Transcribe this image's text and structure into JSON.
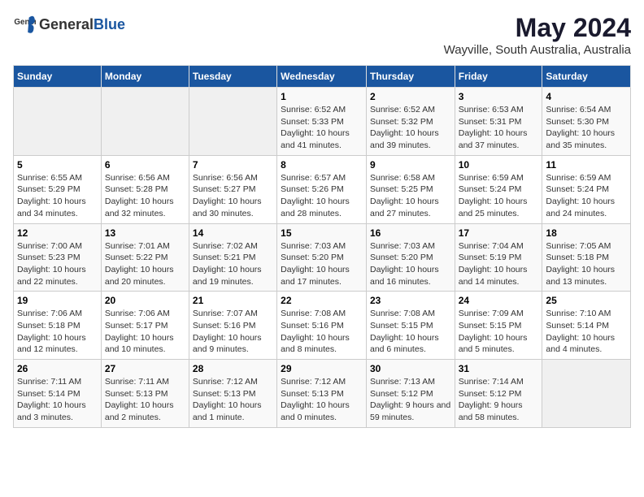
{
  "header": {
    "logo_general": "General",
    "logo_blue": "Blue",
    "title": "May 2024",
    "subtitle": "Wayville, South Australia, Australia"
  },
  "days_of_week": [
    "Sunday",
    "Monday",
    "Tuesday",
    "Wednesday",
    "Thursday",
    "Friday",
    "Saturday"
  ],
  "weeks": [
    [
      {
        "day": "",
        "empty": true
      },
      {
        "day": "",
        "empty": true
      },
      {
        "day": "",
        "empty": true
      },
      {
        "day": "1",
        "sunrise": "Sunrise: 6:52 AM",
        "sunset": "Sunset: 5:33 PM",
        "daylight": "Daylight: 10 hours and 41 minutes."
      },
      {
        "day": "2",
        "sunrise": "Sunrise: 6:52 AM",
        "sunset": "Sunset: 5:32 PM",
        "daylight": "Daylight: 10 hours and 39 minutes."
      },
      {
        "day": "3",
        "sunrise": "Sunrise: 6:53 AM",
        "sunset": "Sunset: 5:31 PM",
        "daylight": "Daylight: 10 hours and 37 minutes."
      },
      {
        "day": "4",
        "sunrise": "Sunrise: 6:54 AM",
        "sunset": "Sunset: 5:30 PM",
        "daylight": "Daylight: 10 hours and 35 minutes."
      }
    ],
    [
      {
        "day": "5",
        "sunrise": "Sunrise: 6:55 AM",
        "sunset": "Sunset: 5:29 PM",
        "daylight": "Daylight: 10 hours and 34 minutes."
      },
      {
        "day": "6",
        "sunrise": "Sunrise: 6:56 AM",
        "sunset": "Sunset: 5:28 PM",
        "daylight": "Daylight: 10 hours and 32 minutes."
      },
      {
        "day": "7",
        "sunrise": "Sunrise: 6:56 AM",
        "sunset": "Sunset: 5:27 PM",
        "daylight": "Daylight: 10 hours and 30 minutes."
      },
      {
        "day": "8",
        "sunrise": "Sunrise: 6:57 AM",
        "sunset": "Sunset: 5:26 PM",
        "daylight": "Daylight: 10 hours and 28 minutes."
      },
      {
        "day": "9",
        "sunrise": "Sunrise: 6:58 AM",
        "sunset": "Sunset: 5:25 PM",
        "daylight": "Daylight: 10 hours and 27 minutes."
      },
      {
        "day": "10",
        "sunrise": "Sunrise: 6:59 AM",
        "sunset": "Sunset: 5:24 PM",
        "daylight": "Daylight: 10 hours and 25 minutes."
      },
      {
        "day": "11",
        "sunrise": "Sunrise: 6:59 AM",
        "sunset": "Sunset: 5:24 PM",
        "daylight": "Daylight: 10 hours and 24 minutes."
      }
    ],
    [
      {
        "day": "12",
        "sunrise": "Sunrise: 7:00 AM",
        "sunset": "Sunset: 5:23 PM",
        "daylight": "Daylight: 10 hours and 22 minutes."
      },
      {
        "day": "13",
        "sunrise": "Sunrise: 7:01 AM",
        "sunset": "Sunset: 5:22 PM",
        "daylight": "Daylight: 10 hours and 20 minutes."
      },
      {
        "day": "14",
        "sunrise": "Sunrise: 7:02 AM",
        "sunset": "Sunset: 5:21 PM",
        "daylight": "Daylight: 10 hours and 19 minutes."
      },
      {
        "day": "15",
        "sunrise": "Sunrise: 7:03 AM",
        "sunset": "Sunset: 5:20 PM",
        "daylight": "Daylight: 10 hours and 17 minutes."
      },
      {
        "day": "16",
        "sunrise": "Sunrise: 7:03 AM",
        "sunset": "Sunset: 5:20 PM",
        "daylight": "Daylight: 10 hours and 16 minutes."
      },
      {
        "day": "17",
        "sunrise": "Sunrise: 7:04 AM",
        "sunset": "Sunset: 5:19 PM",
        "daylight": "Daylight: 10 hours and 14 minutes."
      },
      {
        "day": "18",
        "sunrise": "Sunrise: 7:05 AM",
        "sunset": "Sunset: 5:18 PM",
        "daylight": "Daylight: 10 hours and 13 minutes."
      }
    ],
    [
      {
        "day": "19",
        "sunrise": "Sunrise: 7:06 AM",
        "sunset": "Sunset: 5:18 PM",
        "daylight": "Daylight: 10 hours and 12 minutes."
      },
      {
        "day": "20",
        "sunrise": "Sunrise: 7:06 AM",
        "sunset": "Sunset: 5:17 PM",
        "daylight": "Daylight: 10 hours and 10 minutes."
      },
      {
        "day": "21",
        "sunrise": "Sunrise: 7:07 AM",
        "sunset": "Sunset: 5:16 PM",
        "daylight": "Daylight: 10 hours and 9 minutes."
      },
      {
        "day": "22",
        "sunrise": "Sunrise: 7:08 AM",
        "sunset": "Sunset: 5:16 PM",
        "daylight": "Daylight: 10 hours and 8 minutes."
      },
      {
        "day": "23",
        "sunrise": "Sunrise: 7:08 AM",
        "sunset": "Sunset: 5:15 PM",
        "daylight": "Daylight: 10 hours and 6 minutes."
      },
      {
        "day": "24",
        "sunrise": "Sunrise: 7:09 AM",
        "sunset": "Sunset: 5:15 PM",
        "daylight": "Daylight: 10 hours and 5 minutes."
      },
      {
        "day": "25",
        "sunrise": "Sunrise: 7:10 AM",
        "sunset": "Sunset: 5:14 PM",
        "daylight": "Daylight: 10 hours and 4 minutes."
      }
    ],
    [
      {
        "day": "26",
        "sunrise": "Sunrise: 7:11 AM",
        "sunset": "Sunset: 5:14 PM",
        "daylight": "Daylight: 10 hours and 3 minutes."
      },
      {
        "day": "27",
        "sunrise": "Sunrise: 7:11 AM",
        "sunset": "Sunset: 5:13 PM",
        "daylight": "Daylight: 10 hours and 2 minutes."
      },
      {
        "day": "28",
        "sunrise": "Sunrise: 7:12 AM",
        "sunset": "Sunset: 5:13 PM",
        "daylight": "Daylight: 10 hours and 1 minute."
      },
      {
        "day": "29",
        "sunrise": "Sunrise: 7:12 AM",
        "sunset": "Sunset: 5:13 PM",
        "daylight": "Daylight: 10 hours and 0 minutes."
      },
      {
        "day": "30",
        "sunrise": "Sunrise: 7:13 AM",
        "sunset": "Sunset: 5:12 PM",
        "daylight": "Daylight: 9 hours and 59 minutes."
      },
      {
        "day": "31",
        "sunrise": "Sunrise: 7:14 AM",
        "sunset": "Sunset: 5:12 PM",
        "daylight": "Daylight: 9 hours and 58 minutes."
      },
      {
        "day": "",
        "empty": true
      }
    ]
  ]
}
